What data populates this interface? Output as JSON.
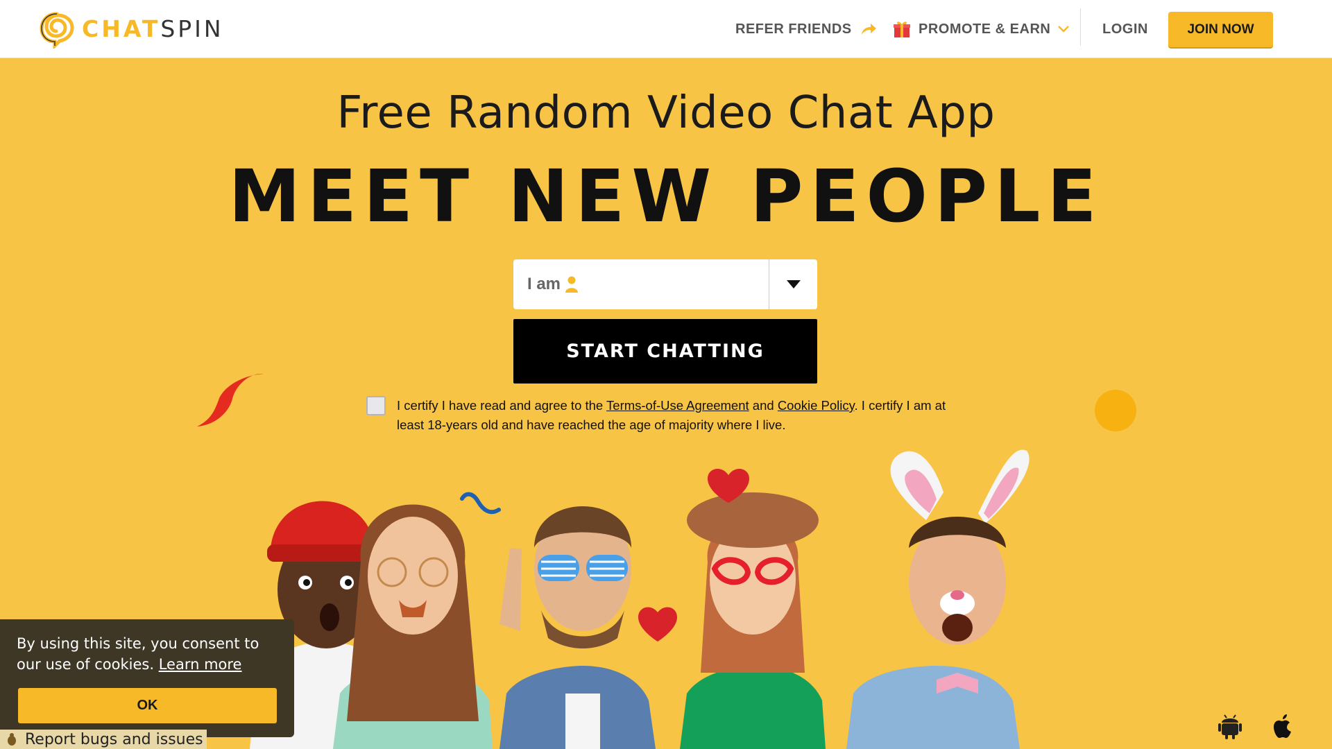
{
  "header": {
    "logo_chat": "CHAT",
    "logo_spin": "SPIN",
    "refer_label": "REFER FRIENDS",
    "promote_label": "PROMOTE & EARN",
    "login_label": "LOGIN",
    "join_label": "JOIN NOW"
  },
  "hero": {
    "subtitle": "Free Random Video Chat App",
    "headline": "MEET NEW PEOPLE",
    "select_value": "I am",
    "start_label": "START CHATTING",
    "certify_before": "I certify I have read and agree to the ",
    "terms_link": "Terms-of-Use Agreement",
    "certify_and": " and ",
    "cookie_link": "Cookie Policy",
    "certify_after": ". I certify I am at least 18-years old and have reached the age of majority where I live."
  },
  "cookie_banner": {
    "text": "By using this site, you consent to our use of cookies.",
    "learn_more": "Learn more",
    "ok_label": "OK"
  },
  "footer": {
    "report_label": "Report bugs and issues"
  },
  "colors": {
    "background": "#f8c446",
    "accent": "#f7b928",
    "button_dark": "#000000"
  },
  "icons": [
    "logo-spiral-icon",
    "arrow-right-icon",
    "gift-icon",
    "chevron-down-icon",
    "user-icon",
    "caret-down-icon",
    "bug-icon",
    "android-icon",
    "apple-icon"
  ]
}
